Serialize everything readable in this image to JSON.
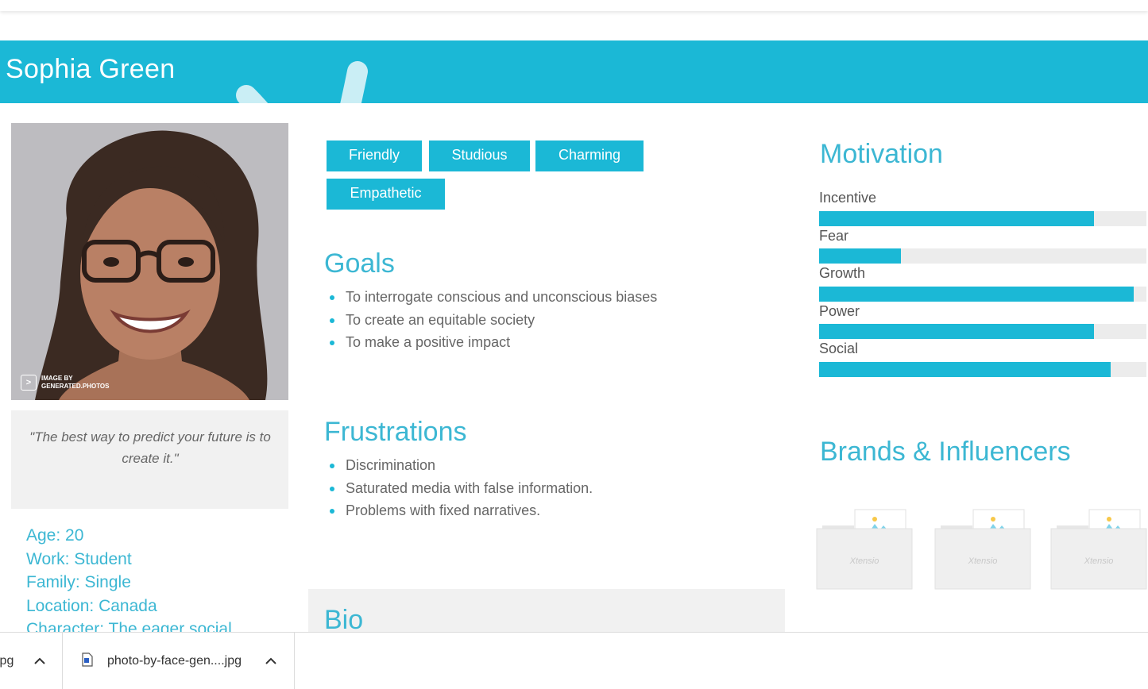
{
  "persona": {
    "name": "Sophia Green",
    "quote": "\"The best way to predict your future is to create it.\"",
    "photo_credit_line1": "IMAGE BY",
    "photo_credit_line2": "GENERATED.PHOTOS",
    "facts": [
      "Age: 20",
      "Work: Student",
      "Family: Single",
      "Location: Canada",
      "Character: The eager social"
    ]
  },
  "traits": [
    "Friendly",
    "Studious",
    "Charming",
    "Empathetic"
  ],
  "goals": {
    "title": "Goals",
    "items": [
      "To interrogate conscious and unconscious biases",
      "To create an equitable society",
      "To make a positive impact"
    ]
  },
  "frustrations": {
    "title": "Frustrations",
    "items": [
      "Discrimination",
      "Saturated media with false information.",
      "Problems with fixed narratives."
    ]
  },
  "bio": {
    "title": "Bio"
  },
  "motivation": {
    "title": "Motivation",
    "items": [
      {
        "label": "Incentive",
        "level": 0.84
      },
      {
        "label": "Fear",
        "level": 0.25
      },
      {
        "label": "Growth",
        "level": 0.96
      },
      {
        "label": "Power",
        "level": 0.84
      },
      {
        "label": "Social",
        "level": 0.89
      }
    ]
  },
  "brands": {
    "title": "Brands & Influencers",
    "placeholder_text": "Xtensio"
  },
  "downloads": [
    {
      "name": "jpg"
    },
    {
      "name": "photo-by-face-gen....jpg"
    }
  ],
  "colors": {
    "accent": "#1bb8d6",
    "panel": "#f1f1f1"
  }
}
